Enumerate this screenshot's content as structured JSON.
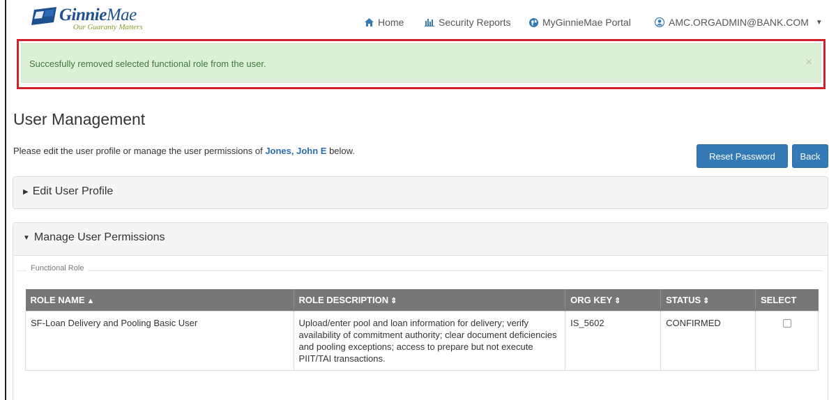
{
  "logo": {
    "brand_bold": "Ginnie",
    "brand_light": "Mae",
    "tagline": "Our Guaranty Matters"
  },
  "nav": {
    "home": "Home",
    "security_reports": "Security Reports",
    "portal": "MyGinnieMae Portal",
    "account": "AMC.ORGADMIN@BANK.COM"
  },
  "alert": {
    "message": "Succesfully removed selected functional role from the user.",
    "close": "×"
  },
  "page": {
    "title": "User Management",
    "intro_before": "Please edit the user profile or manage the user permissions of ",
    "user_name": "Jones, John E",
    "intro_after": " below."
  },
  "buttons": {
    "reset_password": "Reset Password",
    "back": "Back"
  },
  "panels": {
    "edit_profile": "Edit User Profile",
    "manage_permissions": "Manage User Permissions"
  },
  "functional_role": {
    "legend": "Functional Role",
    "columns": [
      "ROLE NAME",
      "ROLE DESCRIPTION",
      "ORG KEY",
      "STATUS",
      "SELECT"
    ],
    "rows": [
      {
        "role_name": "SF-Loan Delivery and Pooling Basic User",
        "role_description": "Upload/enter pool and loan information for delivery; verify availability of commitment authority; clear document deficiencies and pooling exceptions; access to prepare but not execute PIIT/TAI transactions.",
        "org_key": "IS_5602",
        "status": "CONFIRMED",
        "selected": false
      }
    ]
  },
  "colors": {
    "primary": "#337ab7",
    "success_bg": "#dff0d8",
    "success_text": "#3c763d",
    "highlight": "#d2202c",
    "table_header": "#777777"
  }
}
